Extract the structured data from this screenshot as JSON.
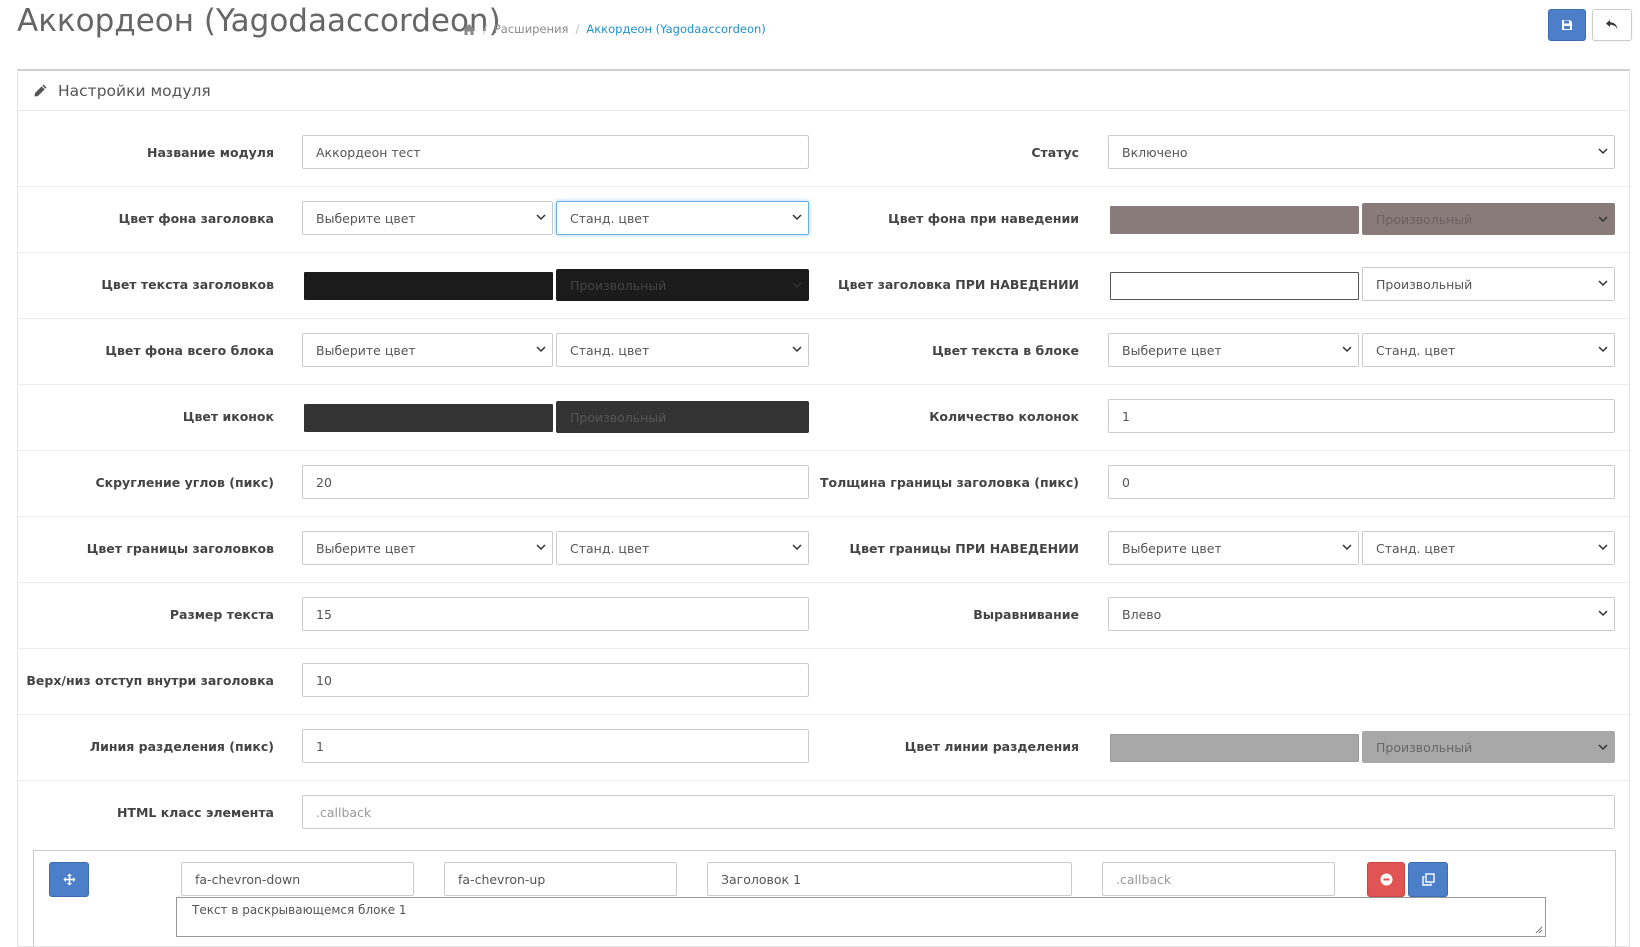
{
  "header": {
    "title": "Аккордеон (Yagodaaccordeon)",
    "breadcrumb": [
      "Расширения",
      "Аккордеон (Yagodaaccordeon)"
    ]
  },
  "panel": {
    "title": "Настройки модуля"
  },
  "form": {
    "module_name": {
      "label": "Название модуля",
      "value": "Аккордеон тест"
    },
    "status": {
      "label": "Статус",
      "value": "Включено"
    },
    "title_bg": {
      "label": "Цвет фона заголовка",
      "select1": "Выберите цвет",
      "select2": "Станд. цвет"
    },
    "hover_bg": {
      "label": "Цвет фона при наведении",
      "select": "Произвольный",
      "color": "#8a7b7b"
    },
    "title_text_color": {
      "label": "Цвет текста заголовков",
      "select": "Произвольный",
      "color": "#1b1b1b"
    },
    "title_hover_color": {
      "label": "Цвет заголовка ПРИ НАВЕДЕНИИ",
      "select": "Произвольный",
      "color": "#ffffff"
    },
    "block_bg": {
      "label": "Цвет фона всего блока",
      "select1": "Выберите цвет",
      "select2": "Станд. цвет"
    },
    "block_text": {
      "label": "Цвет текста в блоке",
      "select1": "Выберите цвет",
      "select2": "Станд. цвет"
    },
    "icon_color": {
      "label": "Цвет иконок",
      "select": "Произвольный",
      "color": "#333333"
    },
    "columns": {
      "label": "Количество колонок",
      "value": "1"
    },
    "radius": {
      "label": "Скругление углов (пикс)",
      "value": "20"
    },
    "border_width": {
      "label": "Толщина границы заголовка (пикс)",
      "value": "0"
    },
    "border_color": {
      "label": "Цвет границы заголовков",
      "select1": "Выберите цвет",
      "select2": "Станд. цвет"
    },
    "border_hover": {
      "label": "Цвет границы ПРИ НАВЕДЕНИИ",
      "select1": "Выберите цвет",
      "select2": "Станд. цвет"
    },
    "font_size": {
      "label": "Размер текста",
      "value": "15"
    },
    "align": {
      "label": "Выравнивание",
      "value": "Влево"
    },
    "padding": {
      "label": "Верх/низ отступ внутри заголовка",
      "value": "10"
    },
    "divider": {
      "label": "Линия разделения (пикс)",
      "value": "1"
    },
    "divider_color": {
      "label": "Цвет линии разделения",
      "select": "Произвольный",
      "color": "#a8a8a8"
    },
    "html_class": {
      "label": "HTML класс элемента",
      "placeholder": ".callback"
    }
  },
  "item": {
    "icon_closed": "fa-chevron-down",
    "icon_open": "fa-chevron-up",
    "title": "Заголовок 1",
    "class_placeholder": ".callback",
    "text": "Текст в раскрывающемся блоке 1"
  },
  "icons": {
    "home": "home-icon",
    "save": "floppy-icon",
    "back": "reply-icon",
    "pencil": "pencil-icon",
    "move": "arrows-icon",
    "remove": "minus-circle-icon",
    "copy": "copy-icon",
    "chevron": "chevron-down-icon"
  },
  "colors": {
    "primary": "#4d7fc8",
    "danger": "#e05454",
    "link": "#1e91cf"
  }
}
